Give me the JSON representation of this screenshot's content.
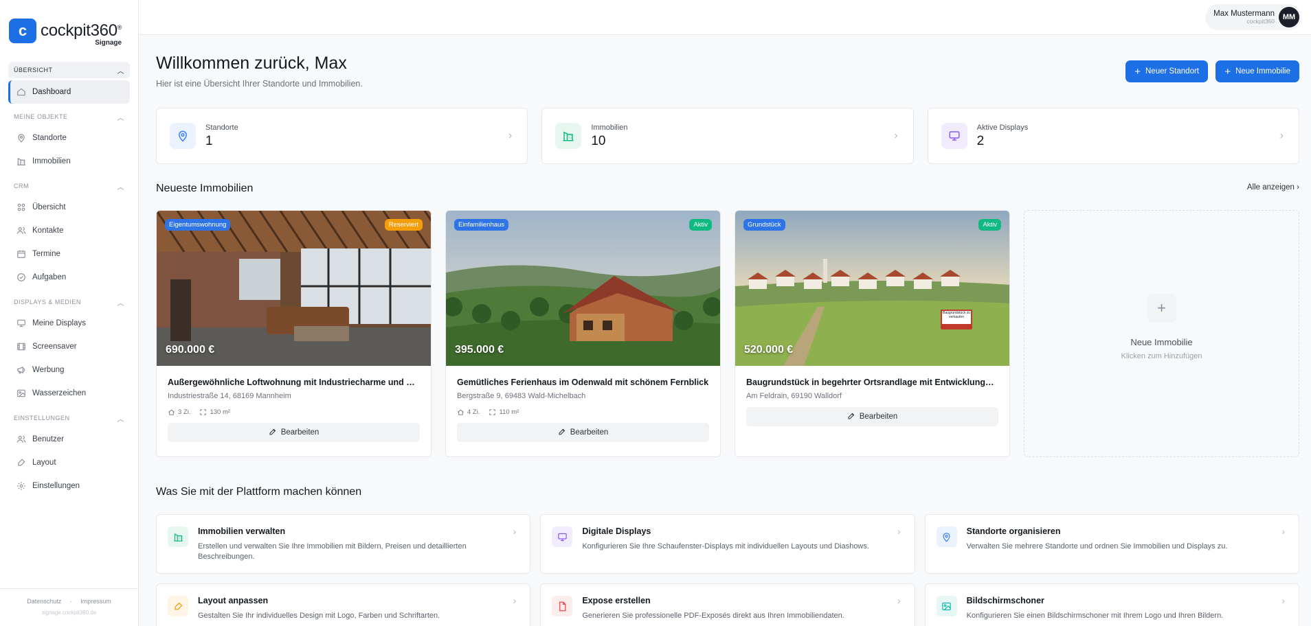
{
  "brand": {
    "mark": "c",
    "name": "cockpit360",
    "reg": "®",
    "sub": "Signage"
  },
  "sidebar": {
    "sections": [
      {
        "title": "Übersicht",
        "items": [
          {
            "label": "Dashboard",
            "icon": "home-icon",
            "active": true
          }
        ]
      },
      {
        "title": "Meine Objekte",
        "items": [
          {
            "label": "Standorte",
            "icon": "map-pin-icon"
          },
          {
            "label": "Immobilien",
            "icon": "building-icon"
          }
        ]
      },
      {
        "title": "CRM",
        "items": [
          {
            "label": "Übersicht",
            "icon": "grid-icon"
          },
          {
            "label": "Kontakte",
            "icon": "users-icon"
          },
          {
            "label": "Termine",
            "icon": "calendar-icon"
          },
          {
            "label": "Aufgaben",
            "icon": "check-circle-icon"
          }
        ]
      },
      {
        "title": "Displays & Medien",
        "items": [
          {
            "label": "Meine Displays",
            "icon": "monitor-icon"
          },
          {
            "label": "Screensaver",
            "icon": "film-icon"
          },
          {
            "label": "Werbung",
            "icon": "megaphone-icon"
          },
          {
            "label": "Wasserzeichen",
            "icon": "image-icon"
          }
        ]
      },
      {
        "title": "Einstellungen",
        "items": [
          {
            "label": "Benutzer",
            "icon": "users-icon"
          },
          {
            "label": "Layout",
            "icon": "brush-icon"
          },
          {
            "label": "Einstellungen",
            "icon": "gear-icon"
          }
        ]
      }
    ],
    "footer": {
      "privacy": "Datenschutz",
      "sep": "·",
      "imprint": "Impressum",
      "domain": "signage.cockpit360.de"
    }
  },
  "user": {
    "name": "Max Mustermann",
    "company": "cockpit360",
    "initials": "MM"
  },
  "welcome": {
    "title": "Willkommen zurück, Max",
    "subtitle": "Hier ist eine Übersicht Ihrer Standorte und Immobilien."
  },
  "actions": {
    "new_location": "Neuer Standort",
    "new_property": "Neue Immobilie"
  },
  "stats": [
    {
      "label": "Standorte",
      "value": "1",
      "icon": "map-pin-icon",
      "color": "#3b82f6",
      "bg": "#eaf2fe"
    },
    {
      "label": "Immobilien",
      "value": "10",
      "icon": "building-icon",
      "color": "#10b981",
      "bg": "#e7f7f0"
    },
    {
      "label": "Aktive Displays",
      "value": "2",
      "icon": "monitor-icon",
      "color": "#8b5cf6",
      "bg": "#f1ecfd"
    }
  ],
  "latest": {
    "title": "Neueste Immobilien",
    "view_all": "Alle anzeigen",
    "cards": [
      {
        "type": "Eigentumswohnung",
        "status": "Reserviert",
        "status_color": "#f59e0b",
        "price": "690.000 €",
        "title": "Außergewöhnliche Loftwohnung mit Industriecharme und off…",
        "address": "Industriestraße 14, 68169 Mannheim",
        "rooms": "3 Zi.",
        "area": "130 m²",
        "edit": "Bearbeiten"
      },
      {
        "type": "Einfamilienhaus",
        "status": "Aktiv",
        "status_color": "#10b981",
        "price": "395.000 €",
        "title": "Gemütliches Ferienhaus im Odenwald mit schönem Fernblick",
        "address": "Bergstraße 9, 69483 Wald-Michelbach",
        "rooms": "4 Zi.",
        "area": "110 m²",
        "edit": "Bearbeiten"
      },
      {
        "type": "Grundstück",
        "status": "Aktiv",
        "status_color": "#10b981",
        "price": "520.000 €",
        "title": "Baugrundstück in begehrter Ortsrandlage mit Entwicklungsm…",
        "address": "Am Feldrain, 69190 Walldorf",
        "edit": "Bearbeiten",
        "sign_text": "Baugrundstück zu verkaufen"
      }
    ],
    "new_card": {
      "plus": "+",
      "title": "Neue Immobilie",
      "subtitle": "Klicken zum Hinzufügen"
    }
  },
  "platform": {
    "title": "Was Sie mit der Plattform machen können",
    "features": [
      {
        "title": "Immobilien verwalten",
        "desc": "Erstellen und verwalten Sie Ihre Immobilien mit Bildern, Preisen und detaillierten Beschreibungen.",
        "icon": "building-icon",
        "color": "#10b981",
        "bg": "#e7f7f0"
      },
      {
        "title": "Digitale Displays",
        "desc": "Konfigurieren Sie Ihre Schaufenster-Displays mit individuellen Layouts und Diashows.",
        "icon": "monitor-icon",
        "color": "#8b5cf6",
        "bg": "#f1ecfd"
      },
      {
        "title": "Standorte organisieren",
        "desc": "Verwalten Sie mehrere Standorte und ordnen Sie Immobilien und Displays zu.",
        "icon": "map-pin-icon",
        "color": "#3b82f6",
        "bg": "#eaf2fe"
      },
      {
        "title": "Layout anpassen",
        "desc": "Gestalten Sie Ihr individuelles Design mit Logo, Farben und Schriftarten.",
        "icon": "brush-icon",
        "color": "#f59e0b",
        "bg": "#fef5e6"
      },
      {
        "title": "Expose erstellen",
        "desc": "Generieren Sie professionelle PDF-Exposés direkt aus Ihren Immobiliendaten.",
        "icon": "file-icon",
        "color": "#ef4444",
        "bg": "#fdecec"
      },
      {
        "title": "Bildschirmschoner",
        "desc": "Konfigurieren Sie einen Bildschirmschoner mit Ihrem Logo und Ihren Bildern.",
        "icon": "image-icon",
        "color": "#14b8a6",
        "bg": "#e6f7f5"
      }
    ]
  }
}
